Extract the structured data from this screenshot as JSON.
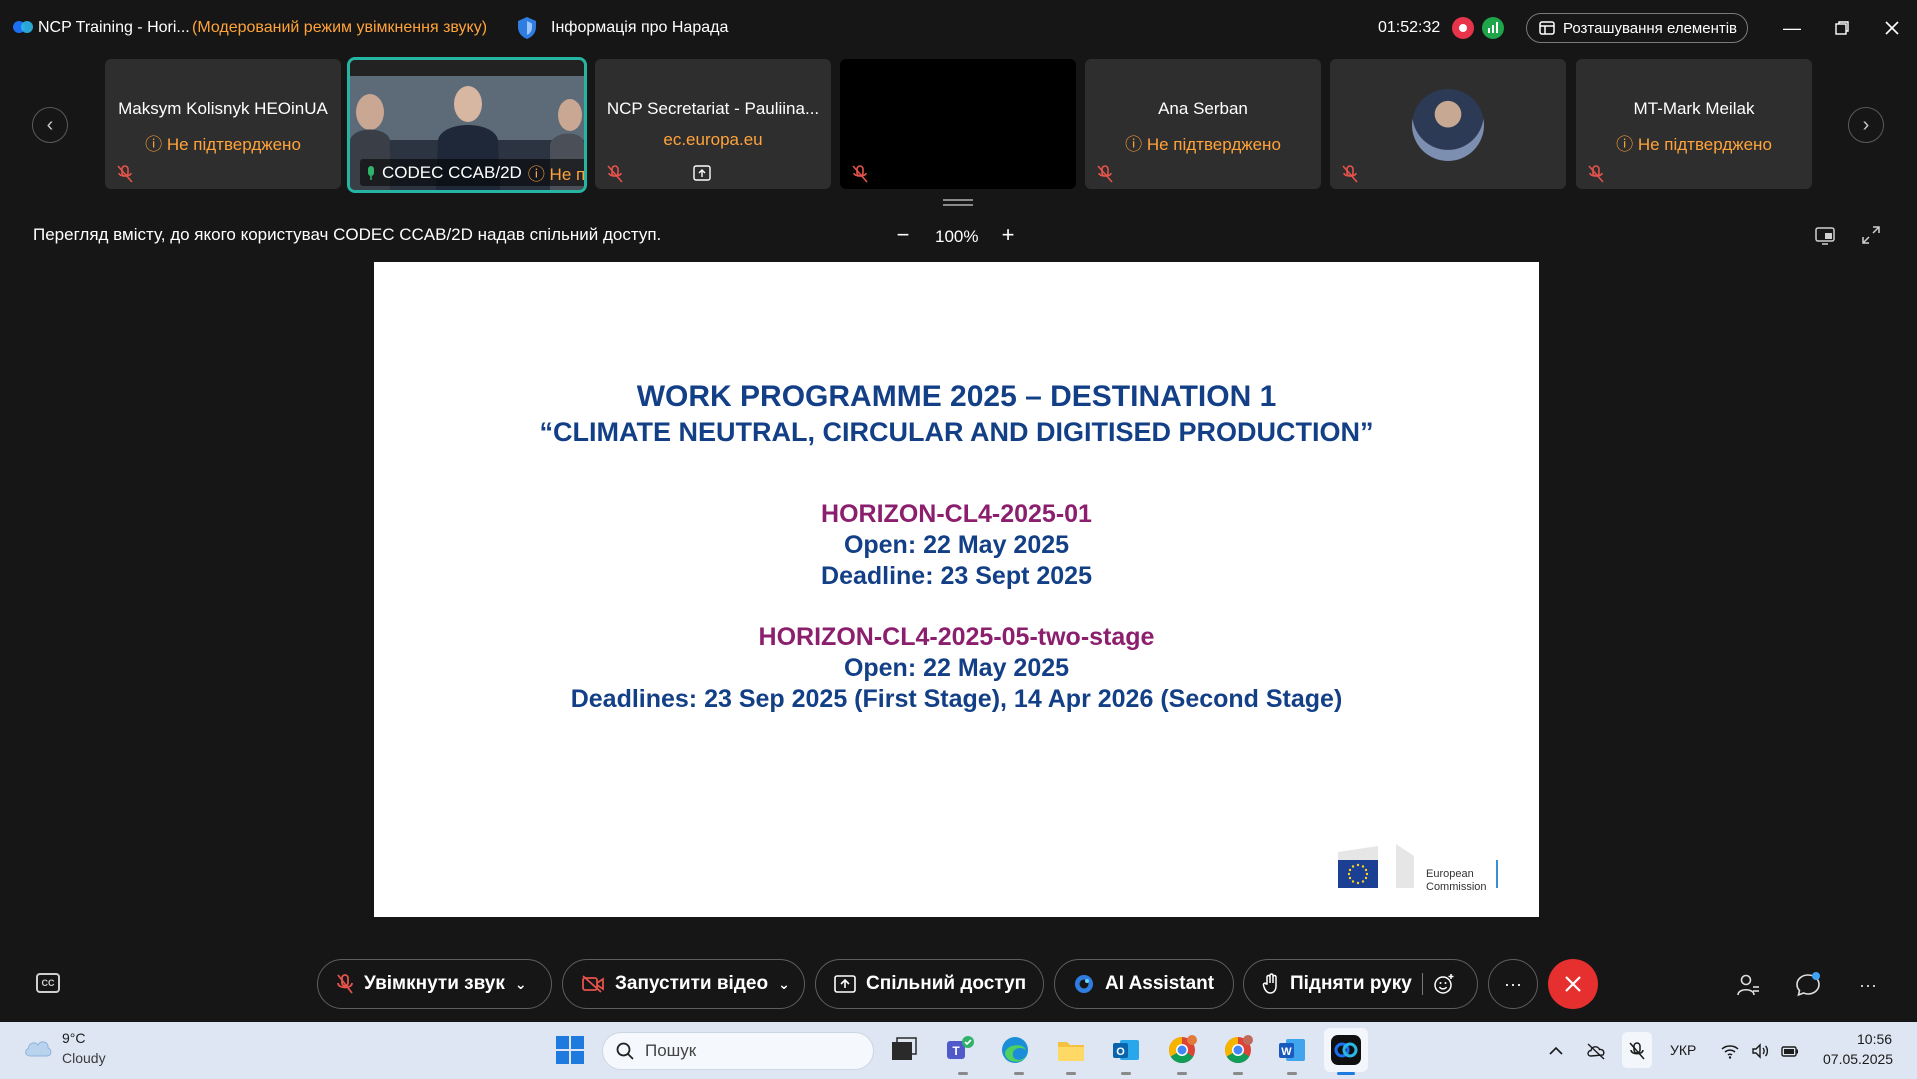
{
  "titlebar": {
    "app_title": "NCP Training - Hori...",
    "audio_mode": "(Модерований режим увімкнення звуку)",
    "meeting_info": "Інформація про Нарада",
    "timer": "01:52:32",
    "layout_button": "Розташування елементів"
  },
  "participants": [
    {
      "name": "Maksym Kolisnyk HEOinUA",
      "status": "Не підтверджено"
    },
    {
      "name": "CODEC CCAB/2D",
      "status": "Не підтверджено"
    },
    {
      "name": "NCP Secretariat - Pauliina...",
      "sub": "ec.europa.eu"
    },
    {
      "name": "",
      "status": ""
    },
    {
      "name": "Ana Serban",
      "status": "Не підтверджено"
    },
    {
      "name": "",
      "status": ""
    },
    {
      "name": "MT-Mark Meilak",
      "status": "Не підтверджено"
    }
  ],
  "content_header": {
    "caption": "Перегляд вмісту, до якого користувач CODEC CCAB/2D надав спільний доступ.",
    "zoom": "100%"
  },
  "slide": {
    "title_line1": "WORK PROGRAMME 2025 – DESTINATION 1",
    "title_line2": "“CLIMATE NEUTRAL, CIRCULAR AND DIGITISED PRODUCTION”",
    "call1_id": "HORIZON-CL4-2025-01",
    "call1_open": "Open: 22 May 2025",
    "call1_deadline": "Deadline: 23 Sept 2025",
    "call2_id": "HORIZON-CL4-2025-05-two-stage",
    "call2_open": "Open: 22 May 2025",
    "call2_deadline": "Deadlines: 23 Sep 2025 (First Stage), 14 Apr 2026 (Second Stage)",
    "logo_line1": "European",
    "logo_line2": "Commission"
  },
  "controls": {
    "unmute": "Увімкнути звук",
    "start_video": "Запустити відео",
    "share": "Спільний доступ",
    "ai_assistant": "AI Assistant",
    "raise_hand": "Підняти руку",
    "cc": "CC"
  },
  "taskbar": {
    "weather_temp": "9°C",
    "weather_desc": "Cloudy",
    "search_placeholder": "Пошук",
    "language": "УКР",
    "time": "10:56",
    "date": "07.05.2025"
  },
  "colors": {
    "accent_orange": "#ffa33a",
    "slide_blue": "#123f86",
    "slide_purple": "#8b1f6e",
    "leave_red": "#e5302f",
    "active_tile_border": "#25b5a3"
  }
}
